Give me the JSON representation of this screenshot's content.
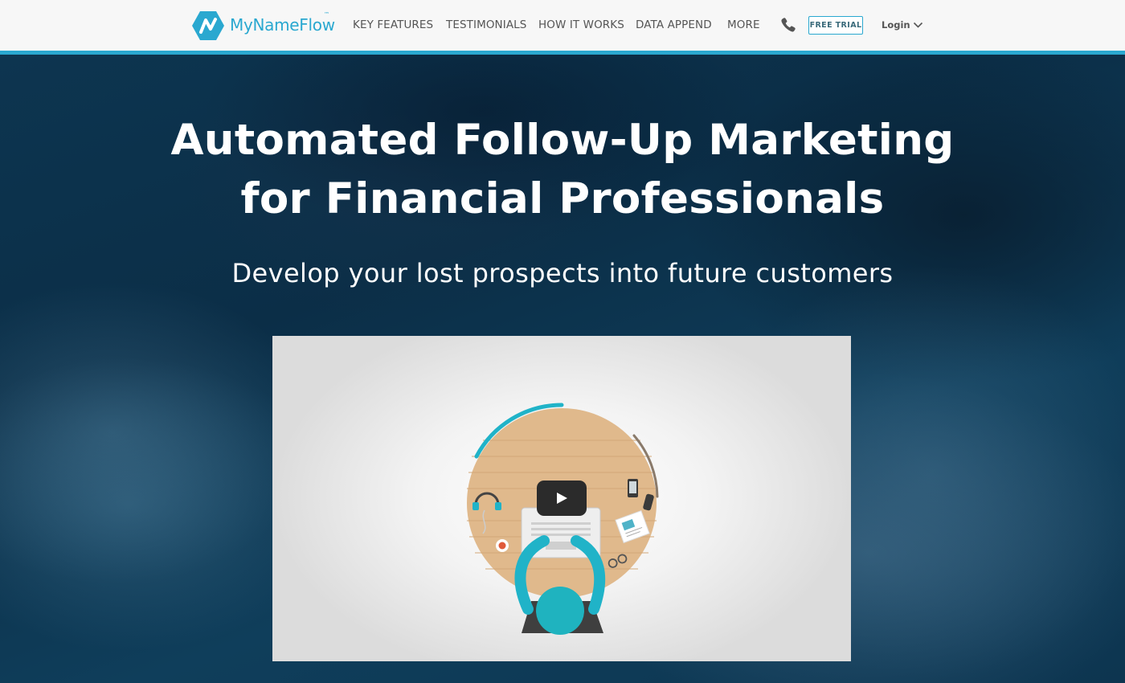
{
  "brand": {
    "name": "MyNameFlow",
    "trademark": "™",
    "logo_icon": "mynameflow-logo-icon",
    "accent_color": "#2aa8d0"
  },
  "nav": {
    "items": [
      {
        "label": "KEY FEATURES"
      },
      {
        "label": "TESTIMONIALS"
      },
      {
        "label": "HOW IT WORKS"
      },
      {
        "label": "DATA APPEND"
      },
      {
        "label": "MORE"
      }
    ],
    "phone_icon": "phone-icon",
    "free_trial_label": "FREE TRIAL",
    "login_label": "Login",
    "login_icon": "chevron-down-icon"
  },
  "hero": {
    "title_line1": "Automated Follow-Up Marketing",
    "title_line2": "for Financial Professionals",
    "subtitle": "Develop your lost prospects into future customers",
    "background_color": "#0d3550"
  },
  "video": {
    "play_icon": "play-icon",
    "illustration": "desk-with-person-illustration"
  }
}
